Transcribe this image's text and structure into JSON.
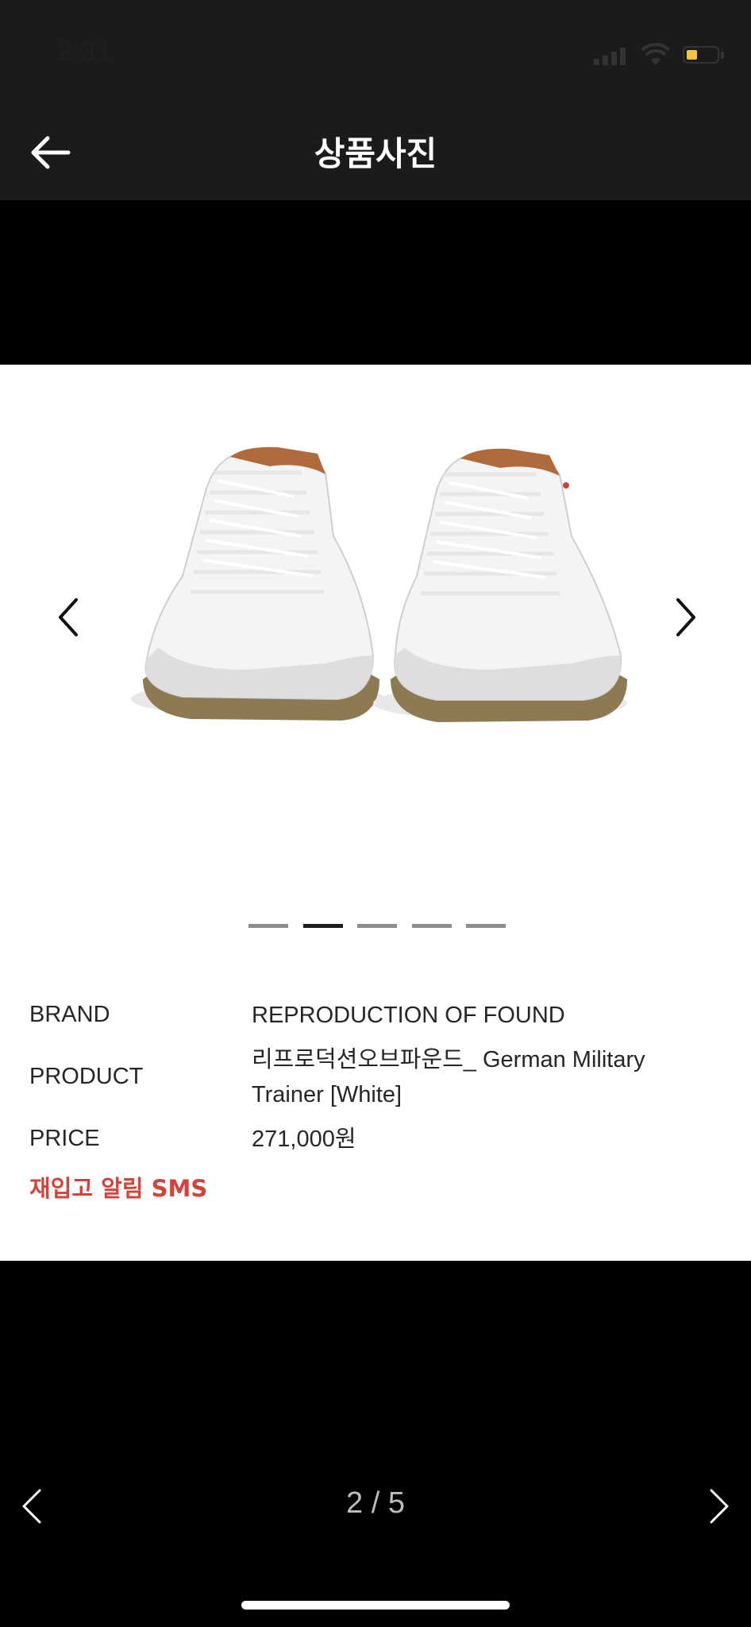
{
  "status_bar": {
    "time": "2:31",
    "signal_icon": "cellular-signal-icon",
    "wifi_icon": "wifi-icon",
    "battery_icon": "battery-icon",
    "battery_level": 0.3,
    "battery_color": "#f4c541"
  },
  "nav": {
    "title": "상품사진",
    "back_icon": "arrow-left-icon"
  },
  "product": {
    "image": "white-sneakers-image",
    "carousel": {
      "prev_icon": "chevron-left-icon",
      "next_icon": "chevron-right-icon",
      "dot_count": 5,
      "active_dot": 2
    },
    "brand_label": "BRAND",
    "brand_value": "REPRODUCTION OF FOUND",
    "product_label": "PRODUCT",
    "product_value_line1": "리프로덕션오브파운드_ German Military",
    "product_value_line2": "Trainer [White]",
    "price_label": "PRICE",
    "price_value": "271,000원",
    "restock_link": "재입고 알림 SMS",
    "restock_color": "#d4433a"
  },
  "pager": {
    "prev_icon": "chevron-left-icon",
    "next_icon": "chevron-right-icon",
    "count": "2 / 5"
  }
}
